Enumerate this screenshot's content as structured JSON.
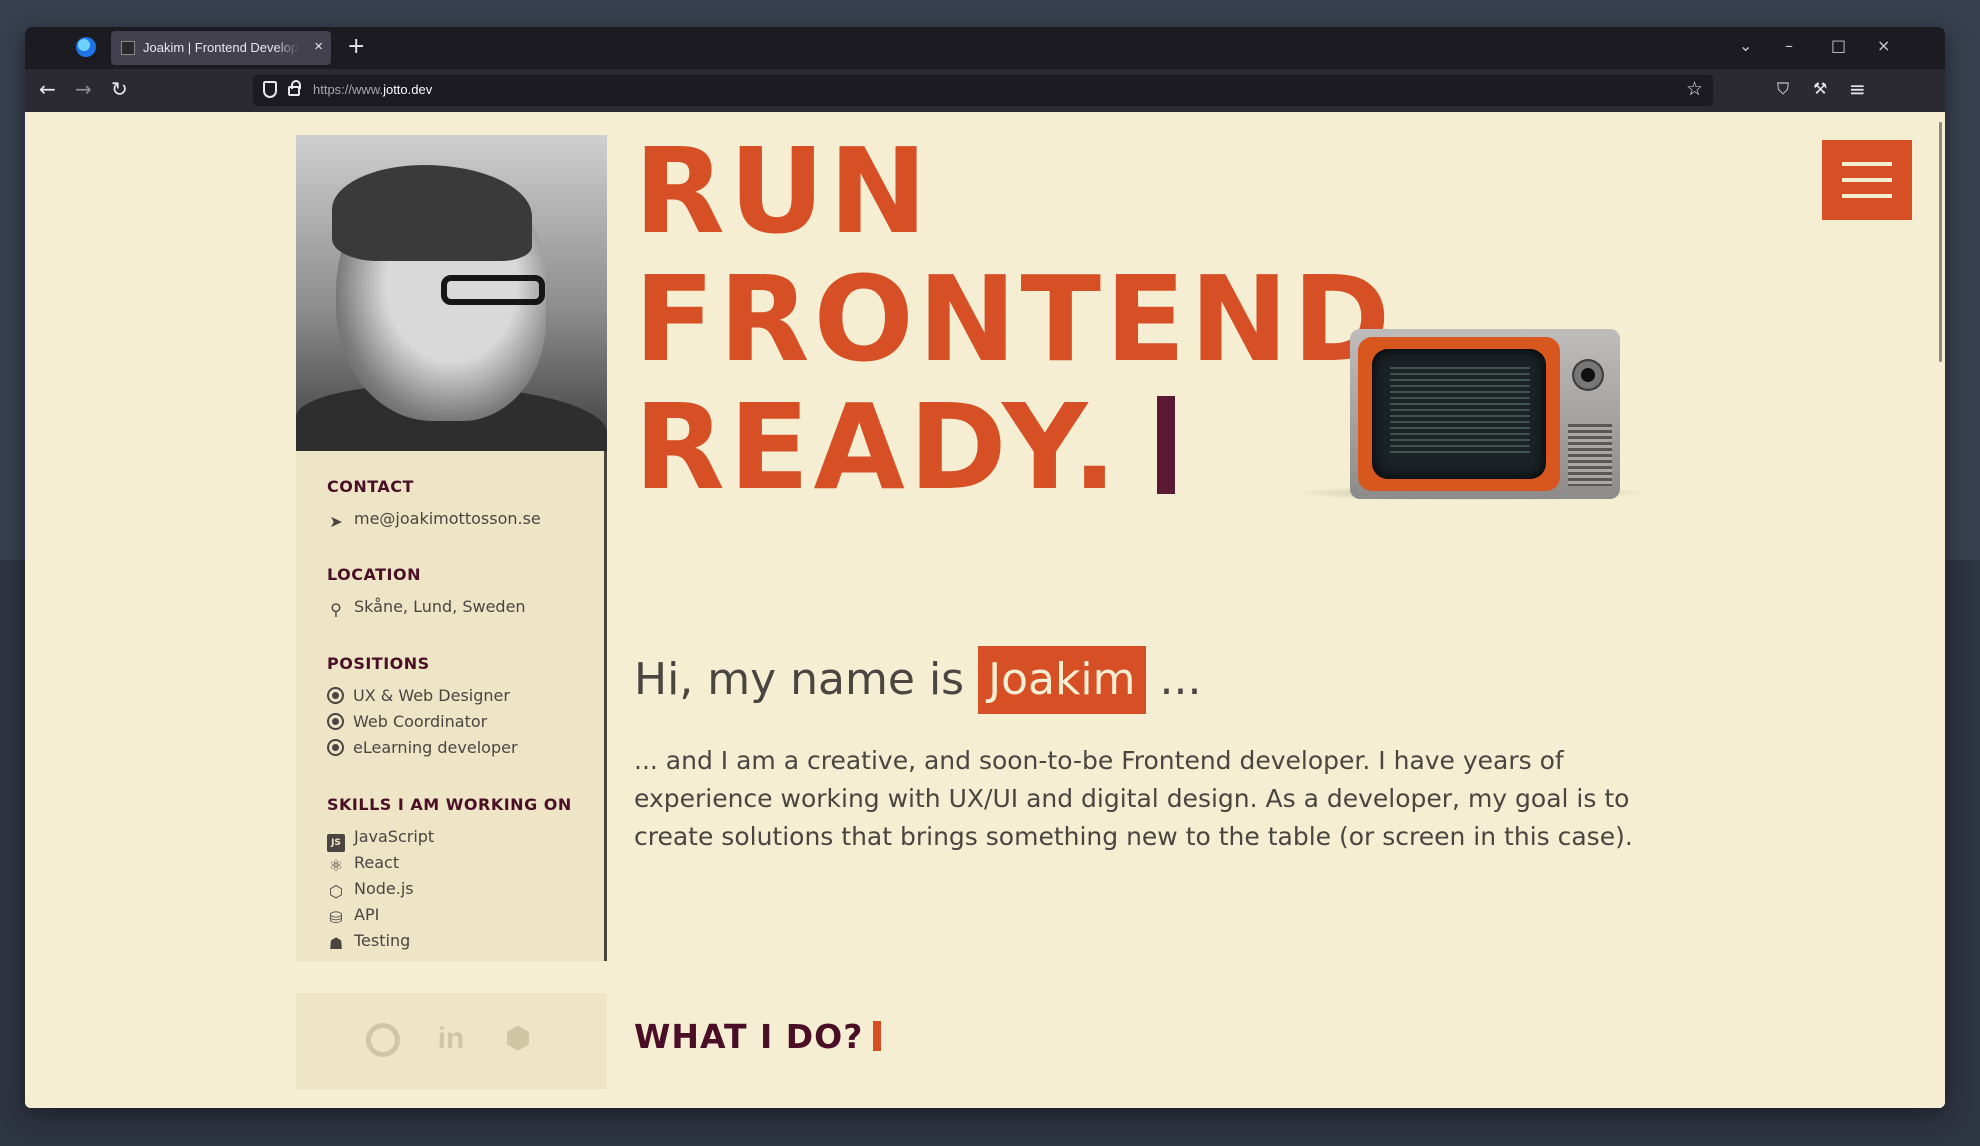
{
  "browser": {
    "tab_title": "Joakim | Frontend Developer student",
    "tab_close": "×",
    "new_tab": "+",
    "url_protocol": "https://www.",
    "url_domain": "jotto.dev",
    "back": "←",
    "forward": "→",
    "reload": "↻",
    "star": "☆",
    "controls": {
      "list": "⌄",
      "minimize": "–",
      "maximize": "□",
      "close": "×"
    },
    "toolbar_icons": {
      "pocket": "⛉",
      "tools": "⚒",
      "menu": "≡"
    }
  },
  "hero": {
    "line1": "RUN",
    "line2": "FRONTEND",
    "line3": "READY."
  },
  "sidebar": {
    "contact": {
      "title": "CONTACT",
      "email": "me@joakimottosson.se",
      "icon": "paper-plane-icon"
    },
    "location": {
      "title": "LOCATION",
      "place": "Skåne, Lund, Sweden",
      "icon": "map-pin-icon"
    },
    "positions": {
      "title": "POSITIONS",
      "items": [
        "UX & Web Designer",
        "Web Coordinator",
        "eLearning developer"
      ]
    },
    "skills": {
      "title": "SKILLS I AM WORKING ON",
      "items": [
        {
          "label": "JavaScript",
          "icon": "js-icon"
        },
        {
          "label": "React",
          "icon": "react-icon"
        },
        {
          "label": "Node.js",
          "icon": "nodejs-icon"
        },
        {
          "label": "API",
          "icon": "database-icon"
        },
        {
          "label": "Testing",
          "icon": "robot-icon"
        }
      ]
    }
  },
  "socials": [
    "github-icon",
    "linkedin-icon",
    "codepen-icon"
  ],
  "greeting": {
    "prefix": "Hi, my name is",
    "name": "Joakim",
    "suffix": "..."
  },
  "intro": "... and I am a creative, and soon-to-be Frontend developer. I have years of experience working with UX/UI and digital design. As a developer, my goal is to create solutions that brings something new to the table (or screen in this case).",
  "what_i_do": {
    "title": "WHAT I DO?"
  },
  "colors": {
    "accent": "#d64f25",
    "dark_accent": "#4a0f26",
    "background": "#f5eed2",
    "sidebar": "#ede5c6",
    "text": "#4b4541"
  }
}
